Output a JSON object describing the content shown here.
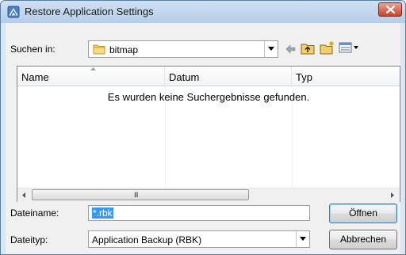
{
  "window": {
    "title": "Restore Application Settings"
  },
  "look_in": {
    "label": "Suchen in:",
    "value": "bitmap"
  },
  "toolbar": {
    "icons": [
      "back-arrow-icon",
      "up-folder-icon",
      "new-folder-icon",
      "view-menu-icon"
    ]
  },
  "list": {
    "columns": [
      "Name",
      "Datum",
      "Typ"
    ],
    "sorted_column": "Name",
    "empty_message": "Es wurden keine Suchergebnisse gefunden.",
    "scroll_grip": "III"
  },
  "file_name": {
    "label": "Dateiname:",
    "value": "*.rbk"
  },
  "file_type": {
    "label": "Dateityp:",
    "value": "Application Backup (RBK)"
  },
  "buttons": {
    "open": "Öffnen",
    "cancel": "Abbrechen"
  },
  "colors": {
    "selection": "#3399ff",
    "close_button": "#c8442c",
    "title_bar": "#b6cde8"
  }
}
